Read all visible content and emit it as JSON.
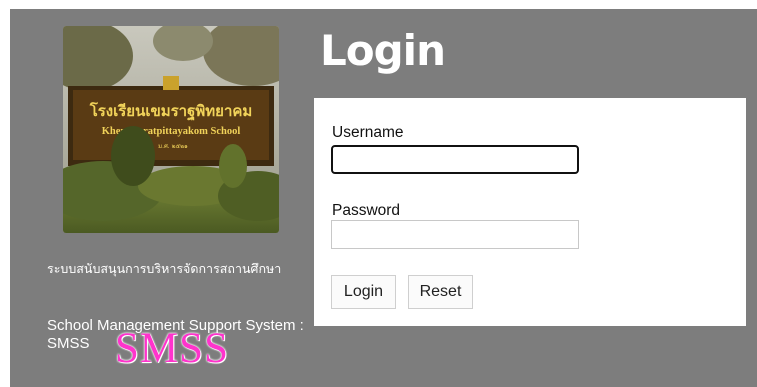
{
  "branding": {
    "sign_thai": "โรงเรียนเขมราฐพิทยาคม",
    "sign_english": "Khemmaratpittayakom School",
    "sign_small": "ม.ศ. ๒๕๒๑",
    "overlay_text": "SMSS",
    "thai_description": "ระบบสนับสนุนการบริหารจัดการสถานศึกษา",
    "english_description": "School Management Support System : SMSS"
  },
  "login": {
    "title": "Login",
    "username_label": "Username",
    "username_value": "",
    "password_label": "Password",
    "password_value": "",
    "login_button": "Login",
    "reset_button": "Reset"
  },
  "colors": {
    "background": "#7d7d7d",
    "panel": "#ffffff",
    "overlay_text": "#ff33cc"
  }
}
